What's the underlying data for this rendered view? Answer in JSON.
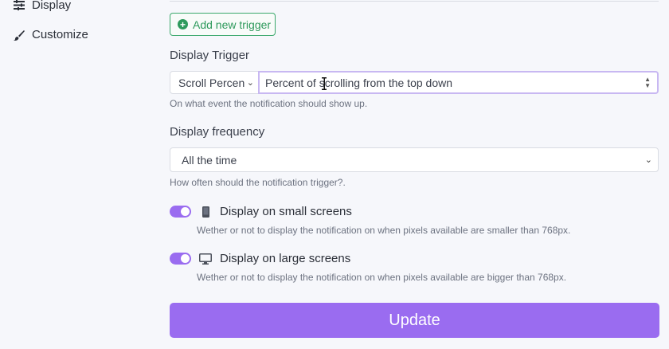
{
  "sidebar": {
    "items": [
      {
        "label": "Display",
        "icon": "sliders-icon"
      },
      {
        "label": "Customize",
        "icon": "brush-icon"
      }
    ]
  },
  "trigger": {
    "add_button_label": "Add new trigger",
    "title": "Display Trigger",
    "type_selected": "Scroll Percen",
    "value_placeholder": "Percent of scrolling from the top down",
    "help": "On what event the notification should show up."
  },
  "frequency": {
    "title": "Display frequency",
    "selected": "All the time",
    "help": "How often should the notification trigger?."
  },
  "small_screens": {
    "enabled": true,
    "label": "Display on small screens",
    "icon": "mobile-icon",
    "help": "Wether or not to display the notification on when pixels available are smaller than 768px."
  },
  "large_screens": {
    "enabled": true,
    "label": "Display on large screens",
    "icon": "desktop-icon",
    "help": "Wether or not to display the notification on when pixels available are bigger than 768px."
  },
  "update_label": "Update",
  "colors": {
    "accent": "#9a6cf0",
    "success": "#2e9a5c",
    "background": "#f6f7fb"
  }
}
